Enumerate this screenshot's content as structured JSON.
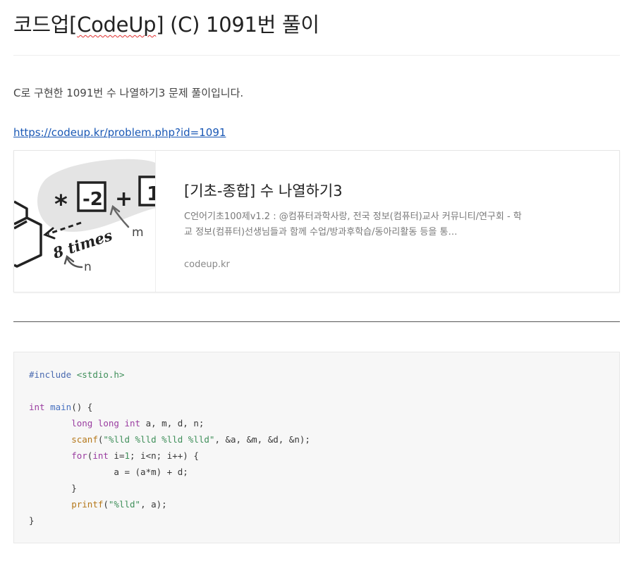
{
  "post": {
    "title_prefix": "코드업[",
    "title_spell": "CodeUp",
    "title_suffix": "] (C) 1091번 풀이",
    "intro": "C로 구현한 1091번 수 나열하기3 문제 풀이입니다.",
    "link": "https://codeup.kr/problem.php?id=1091"
  },
  "link_card": {
    "title": "[기초-종합] 수 나열하기3",
    "description": "C언어기초100제v1.2 : @컴퓨터과학사랑, 전국 정보(컴퓨터)교사 커뮤니티/연구회 - 학교 정보(컴퓨터)선생님들과 함께 수업/방과후학습/동아리활동 등을 통…",
    "host": "codeup.kr",
    "thumbnail": {
      "operator_times": "*",
      "operand_1": "-2",
      "operator_plus": "+",
      "operand_2": "1",
      "label_times": "8 times",
      "label_m": "m",
      "label_n": "n"
    }
  },
  "code": {
    "l1_pre": "#include",
    "l1_inc": "<stdio.h>",
    "l3_kw": "int",
    "l3_fn": "main",
    "l3_rest": "() {",
    "l4_kw": "long long int",
    "l4_rest": " a, m, d, n;",
    "l5_bi": "scanf",
    "l5_a": "(",
    "l5_str": "\"%lld %lld %lld %lld\"",
    "l5_rest": ", &a, &m, &d, &n);",
    "l6_kw1": "for",
    "l6_a": "(",
    "l6_kw2": "int",
    "l6_b": " i=",
    "l6_num": "1",
    "l6_rest": "; i<n; i++) {",
    "l7": "a = (a*m) + d;",
    "l8": "}",
    "l9_bi": "printf",
    "l9_a": "(",
    "l9_str": "\"%lld\"",
    "l9_rest": ", a);",
    "l10": "}"
  },
  "colors": {
    "link": "#1a58b5",
    "code_background": "#f7f7f7",
    "keyword": "#9a3da0",
    "string": "#3f8f5a",
    "builtin": "#b5781a"
  }
}
